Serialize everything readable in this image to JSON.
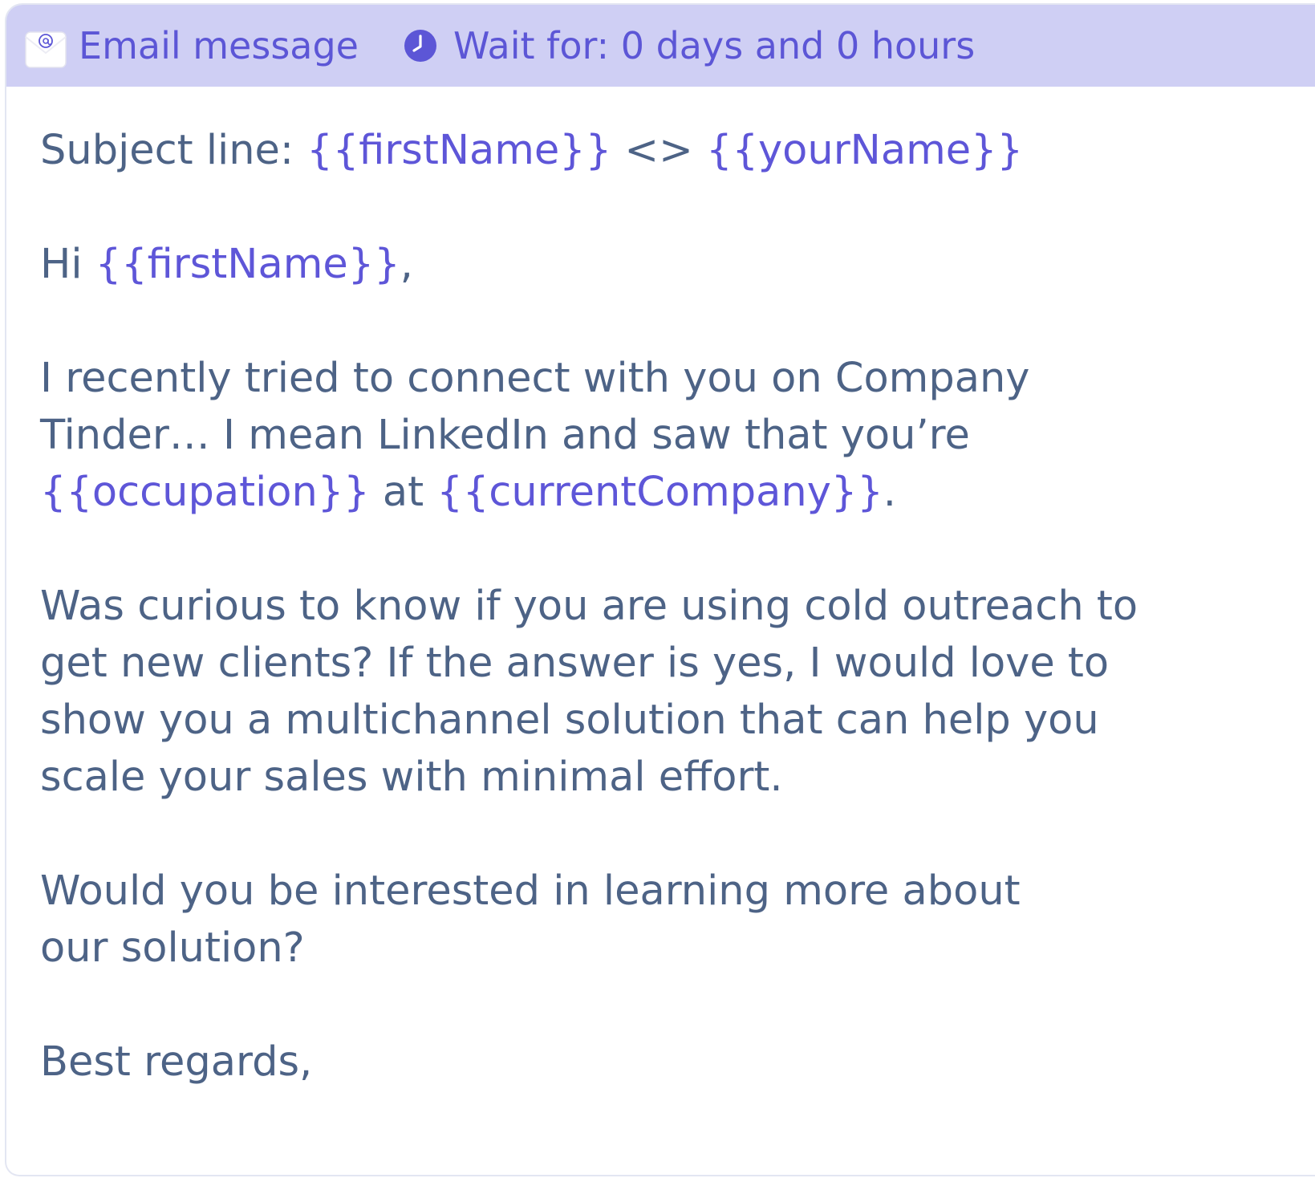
{
  "header": {
    "email_label": "Email message",
    "email_icon": "email-envelope-icon",
    "wait_label": "Wait for: 0 days and 0 hours",
    "wait_icon": "clock-icon"
  },
  "colors": {
    "header_bg": "#cfcff4",
    "accent": "#5c56d6",
    "body_text": "#4d6386"
  },
  "email": {
    "subject_prefix": "Subject line: ",
    "subject_var1": "{{firstName}}",
    "subject_sep": " <> ",
    "subject_var2": "{{yourName}}",
    "greeting_prefix": "Hi ",
    "greeting_var": "{{firstName}}",
    "greeting_suffix": ",",
    "p1_line1": "I recently tried to connect with you on Company",
    "p1_line2": "Tinder… I mean LinkedIn and saw that you’re",
    "p1_var1": "{{occupation}}",
    "p1_mid": " at ",
    "p1_var2": "{{currentCompany}}",
    "p1_end": ".",
    "p2_line1": "Was curious to know if you are using cold outreach to",
    "p2_line2": "get new clients? If the answer is yes, I would love to",
    "p2_line3": "show you a multichannel solution that can help you",
    "p2_line4": "scale your sales with minimal effort.",
    "p3_line1": "Would you be interested in learning more about",
    "p3_line2": "our solution?",
    "closing": "Best regards,"
  }
}
